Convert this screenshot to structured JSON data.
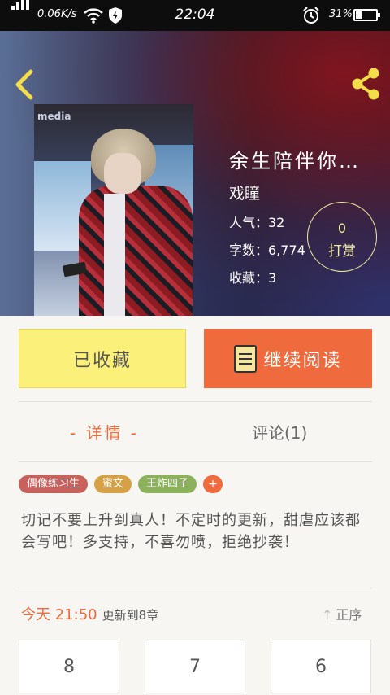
{
  "status_bar": {
    "net_speed": "0.06K/s",
    "time": "22:04",
    "battery_pct": "31%",
    "icons": [
      "signal-icon",
      "wifi-icon",
      "shield-icon",
      "alarm-icon",
      "battery-icon"
    ]
  },
  "header": {
    "back_icon": "chevron-left-icon",
    "share_icon": "share-icon",
    "icon_color": "#f3de4a"
  },
  "book": {
    "title": "余生陪伴你…",
    "author": "戏瞳",
    "popularity": "人气：32",
    "word_count": "字数：6,774",
    "favorites": "收藏：3",
    "reward_count": "0",
    "reward_label": "打赏"
  },
  "actions": {
    "favorited_label": "已收藏",
    "continue_label": "继续阅读",
    "continue_icon": "book-icon"
  },
  "tabs": [
    {
      "label": "- 详情 -",
      "active": true
    },
    {
      "label": "评论(1)",
      "active": false
    }
  ],
  "tags": [
    {
      "label": "偶像练习生",
      "color": "#c8615c"
    },
    {
      "label": "蜜文",
      "color": "#d6a146"
    },
    {
      "label": "王炸四子",
      "color": "#8bb15b"
    }
  ],
  "tag_add": "+",
  "description": "切记不要上升到真人！不定时的更新，甜虐应该都会写吧！多支持，不喜勿喷，拒绝抄袭！",
  "update": {
    "time": "今天 21:50",
    "text": "更新到8章"
  },
  "order": {
    "label": "正序",
    "icon": "arrow-up-icon"
  },
  "chapters": [
    "8",
    "7",
    "6"
  ],
  "colors": {
    "accent": "#ef6b3d",
    "fav_button": "#fbf07a"
  }
}
